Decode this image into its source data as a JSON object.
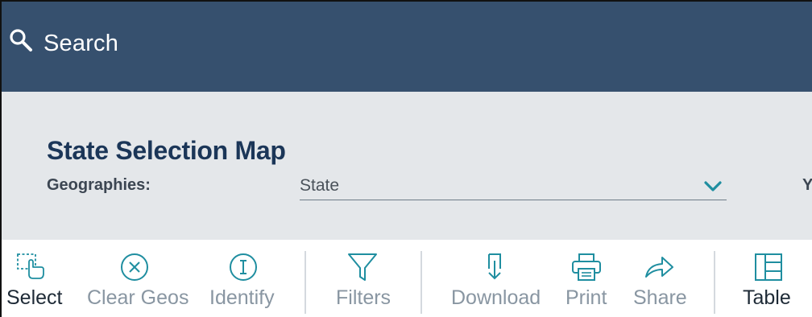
{
  "search": {
    "label": "Search"
  },
  "panel": {
    "title": "State Selection Map",
    "geographies_label": "Geographies:",
    "geographies_value": "State",
    "next_label_partial": "Y"
  },
  "toolbar": {
    "items": [
      {
        "label": "Select",
        "icon": "select-pointer-icon",
        "active": true
      },
      {
        "label": "Clear Geos",
        "icon": "clear-circle-x-icon",
        "active": false
      },
      {
        "label": "Identify",
        "icon": "info-circle-icon",
        "active": false
      },
      {
        "label": "Filters",
        "icon": "filter-funnel-icon",
        "active": false
      },
      {
        "label": "Download",
        "icon": "download-icon",
        "active": false
      },
      {
        "label": "Print",
        "icon": "printer-icon",
        "active": false
      },
      {
        "label": "Share",
        "icon": "share-arrow-icon",
        "active": false
      },
      {
        "label": "Table",
        "icon": "table-icon",
        "active": true
      }
    ]
  },
  "colors": {
    "header_bg": "#36506e",
    "panel_bg": "#e4e7ea",
    "title": "#1b3658",
    "accent": "#1f8ea0",
    "inactive_tool": "#8996a2"
  }
}
